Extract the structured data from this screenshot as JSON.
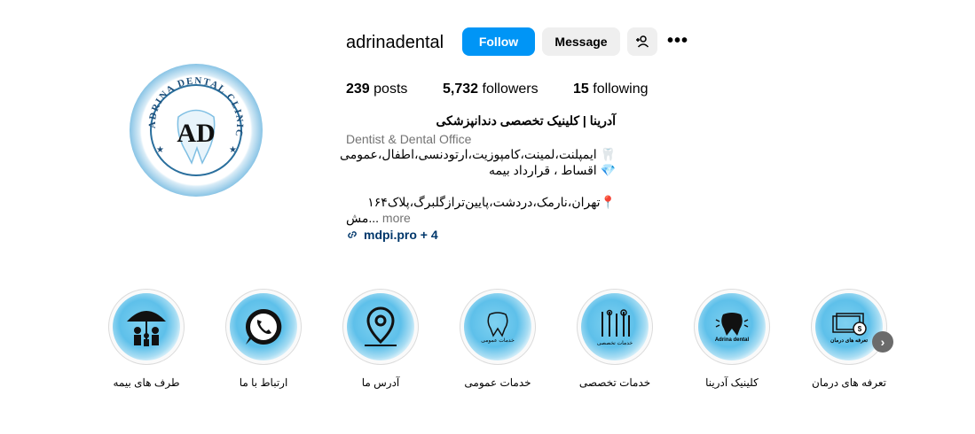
{
  "profile": {
    "username": "adrinadental",
    "follow_label": "Follow",
    "message_label": "Message",
    "add_user_icon": "person-add-icon",
    "more_icon": "more-horizontal-icon",
    "avatar_text": "ADRINA DENTAL CLINIC",
    "avatar_monogram": "AD"
  },
  "stats": {
    "posts_count": "239",
    "posts_label": "posts",
    "followers_count": "5,732",
    "followers_label": "followers",
    "following_count": "15",
    "following_label": "following"
  },
  "bio": {
    "name": "آدرینا | کلینیک تخصصی دندانپزشکی",
    "category": "Dentist & Dental Office",
    "line1": "🦷 ایمپلنت،لمینت،کامپوزیت،ارتودنسی،اطفال،عمومی",
    "line2": "💎 اقساط ، قرارداد بیمه",
    "line3": "📍تهران،نارمک،دردشت،پایین‌ترازگلبرگ،پلاک۱۶۴",
    "line4": "مش...",
    "more_label": "more",
    "link_text": "mdpi.pro + 4",
    "link_icon": "link-icon"
  },
  "highlights": [
    {
      "label": "طرف های بیمه",
      "icon": "umbrella-family-icon"
    },
    {
      "label": "ارتباط با ما",
      "icon": "whatsapp-icon"
    },
    {
      "label": "آدرس ما",
      "icon": "location-pin-icon"
    },
    {
      "label": "خدمات عمومی",
      "icon": "tooth-icon",
      "caption": "خدمات عمومی"
    },
    {
      "label": "خدمات تخصصی",
      "icon": "dental-tools-icon",
      "caption": "خدمات تخصصی"
    },
    {
      "label": "کلینیک آدرینا",
      "icon": "tooth-icon",
      "caption": "Adrina dental"
    },
    {
      "label": "تعرفه های درمان",
      "icon": "money-icon",
      "caption": "تعرفه های درمان"
    }
  ],
  "nav": {
    "next_icon": "chevron-right-icon"
  },
  "colors": {
    "accent": "#0095f6",
    "highlight_blue": "#5ec0ea",
    "logo_blue": "#2f7fb5"
  }
}
